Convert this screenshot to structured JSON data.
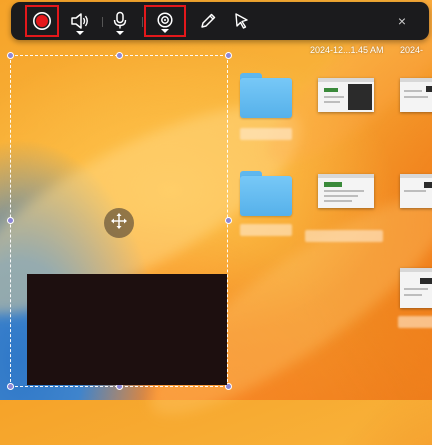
{
  "toolbar": {
    "record_state": "recording",
    "audio": {
      "has_dropdown": true
    },
    "microphone": {
      "has_dropdown": true
    },
    "webcam": {
      "has_dropdown": true
    },
    "close_label": "×",
    "highlighted": [
      "record-button",
      "webcam-button"
    ]
  },
  "desktop": {
    "timestamp_1": "2024-12...1.45 AM",
    "timestamp_2": "2024-"
  },
  "capture_region": {
    "move_icon": "move-arrows-icon",
    "webcam_preview": "dark"
  },
  "colors": {
    "toolbar_bg": "#1b1b1d",
    "record_red": "#e4181b",
    "highlight_border": "#e4181b",
    "handle": "#8c86d6",
    "folder": "#66bdf2"
  }
}
